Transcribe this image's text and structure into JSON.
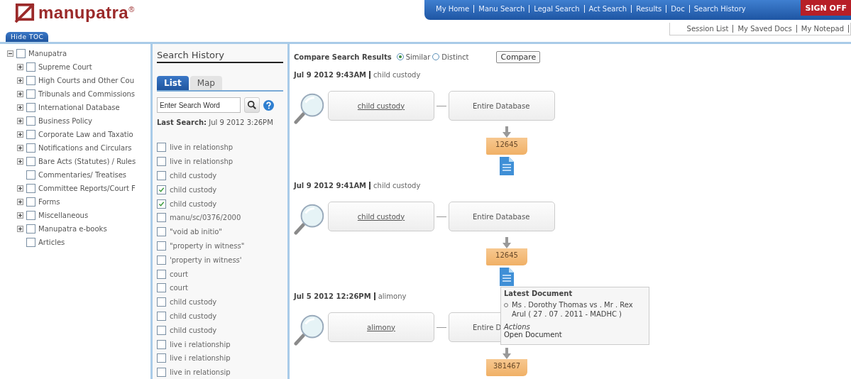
{
  "header": {
    "logo": "manupatra$^{®}$",
    "nav": [
      "My Home",
      "Manu Search",
      "Legal Search",
      "Act Search",
      "Results",
      "Doc",
      "Search History"
    ],
    "sign_off": "SIGN OFF",
    "sub_nav": [
      "Session List",
      "My Saved Docs",
      "My Notepad"
    ],
    "hide_toc": "Hide TOC"
  },
  "toc": {
    "label": "Manupatra",
    "checked": false,
    "expanded": true,
    "children": [
      {
        "label": "Supreme Court",
        "checked": false,
        "expanded": false
      },
      {
        "label": "High Courts and Other Cou",
        "checked": false,
        "expanded": false
      },
      {
        "label": "Tribunals and Commissions",
        "checked": false,
        "expanded": false
      },
      {
        "label": "International Database",
        "checked": false,
        "expanded": false
      },
      {
        "label": "Business Policy",
        "checked": false,
        "expanded": false
      },
      {
        "label": "Corporate Law and Taxatio",
        "checked": false,
        "expanded": false
      },
      {
        "label": "Notifications and Circulars",
        "checked": false,
        "expanded": false
      },
      {
        "label": "Bare Acts (Statutes) / Rules",
        "checked": false,
        "expanded": false
      },
      {
        "label": "Commentaries/ Treatises",
        "checked": false
      },
      {
        "label": "Committee Reports/Court F",
        "checked": false,
        "expanded": false
      },
      {
        "label": "Forms",
        "checked": false,
        "expanded": false
      },
      {
        "label": "Miscellaneous",
        "checked": false,
        "expanded": false
      },
      {
        "label": "Manupatra e-books",
        "checked": false,
        "expanded": false
      },
      {
        "label": "Articles",
        "checked": false
      }
    ]
  },
  "history": {
    "title": "Search History",
    "tabs": [
      {
        "label": "List",
        "selected": true
      },
      {
        "label": "Map",
        "selected": false
      }
    ],
    "search": {
      "placeholder": "Enter Search Word"
    },
    "last_search_label": "Last Search:",
    "last_search": "Jul 9 2012 3:26PM",
    "items": [
      {
        "label": "live in relationshp",
        "checked": false
      },
      {
        "label": "live in relationshp",
        "checked": false
      },
      {
        "label": "child custody",
        "checked": false
      },
      {
        "label": "child custody",
        "checked": true
      },
      {
        "label": "child custody",
        "checked": true
      },
      {
        "label": "manu/sc/0376/2000",
        "checked": false
      },
      {
        "label": "\"void ab initio\"",
        "checked": false
      },
      {
        "label": "\"property in witness\"",
        "checked": false
      },
      {
        "label": "'property in witness'",
        "checked": false
      },
      {
        "label": "court",
        "checked": false
      },
      {
        "label": "court",
        "checked": false
      },
      {
        "label": "child custody",
        "checked": false
      },
      {
        "label": "child custody",
        "checked": false
      },
      {
        "label": "child custody",
        "checked": false
      },
      {
        "label": "live i relationship",
        "checked": false
      },
      {
        "label": "live i relationship",
        "checked": false
      },
      {
        "label": "live in relationsip",
        "checked": false
      }
    ]
  },
  "compare": {
    "label": "Compare Search Results",
    "options": [
      {
        "label": "Similar",
        "selected": true
      },
      {
        "label": "Distinct",
        "selected": false
      }
    ],
    "button": "Compare"
  },
  "searches": [
    {
      "date": "Jul 9 2012 9:43AM",
      "query": "child custody",
      "node_query": "child custody",
      "node_scope": "Entire Database",
      "count": "12645",
      "document_icon": true
    },
    {
      "date": "Jul 9 2012 9:41AM",
      "query": "child custody",
      "node_query": "child custody",
      "node_scope": "Entire Database",
      "count": "12645",
      "document_icon": true
    },
    {
      "date": "Jul 5 2012 12:26PM",
      "query": "alimony",
      "node_query": "alimony",
      "node_scope": "Entire D",
      "count": "381467",
      "document_icon": false
    }
  ],
  "tooltip": {
    "title": "Latest Document",
    "items": [
      "Ms . Dorothy Thomas vs . Mr . Rex Arul ( 27 . 07 . 2011 - MADHC )"
    ],
    "actions_label": "Actions",
    "action": "Open Document"
  }
}
